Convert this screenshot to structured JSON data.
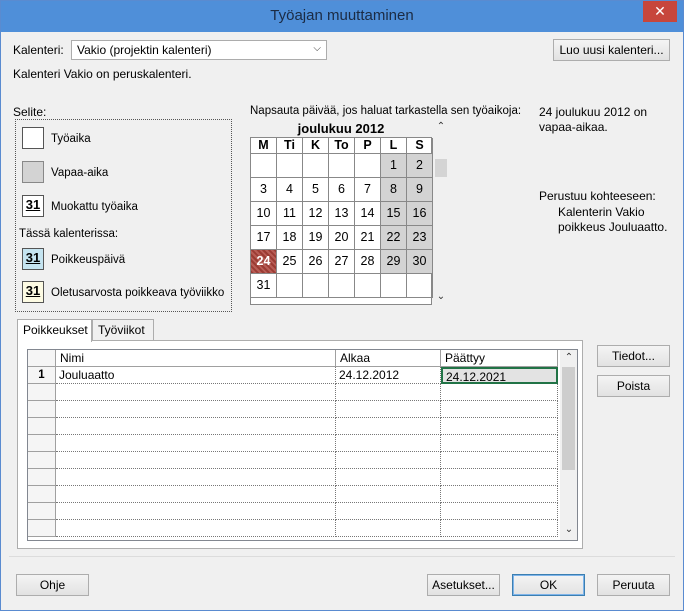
{
  "window": {
    "title": "Työajan muuttaminen",
    "close": "✕"
  },
  "calendar_select": {
    "label": "Kalenteri:",
    "value": "Vakio (projektin kalenteri)",
    "new_button": "Luo uusi kalenteri...",
    "base_note": "Kalenteri Vakio on peruskalenteri."
  },
  "legend": {
    "title": "Selite:",
    "items": [
      {
        "label": "Työaika"
      },
      {
        "label": "Vapaa-aika"
      },
      {
        "label": "Muokattu työaika",
        "num": "31"
      }
    ],
    "in_calendar": "Tässä kalenterissa:",
    "items2": [
      {
        "label": "Poikkeuspäivä",
        "num": "31"
      },
      {
        "label": "Oletusarvosta poikkeava työviikko",
        "num": "31"
      }
    ]
  },
  "month_view": {
    "instruction": "Napsauta päivää, jos haluat tarkastella sen työaikoja:",
    "month": "joulukuu 2012",
    "weekdays": [
      "M",
      "Ti",
      "K",
      "To",
      "P",
      "L",
      "S"
    ],
    "weeks": [
      [
        "",
        "",
        "",
        "",
        "",
        "1",
        "2"
      ],
      [
        "3",
        "4",
        "5",
        "6",
        "7",
        "8",
        "9"
      ],
      [
        "10",
        "11",
        "12",
        "13",
        "14",
        "15",
        "16"
      ],
      [
        "17",
        "18",
        "19",
        "20",
        "21",
        "22",
        "23"
      ],
      [
        "24",
        "25",
        "26",
        "27",
        "28",
        "29",
        "30"
      ],
      [
        "31",
        "",
        "",
        "",
        "",
        "",
        ""
      ]
    ],
    "selected_day": "24"
  },
  "info": {
    "selected_text": "24 joulukuu 2012 on vapaa-aikaa.",
    "based_on_title": "Perustuu kohteeseen:",
    "based_on_text": "Kalenterin Vakio poikkeus Jouluaatto."
  },
  "tabs": [
    {
      "label": "Poikkeukset"
    },
    {
      "label": "Työviikot"
    }
  ],
  "exceptions": {
    "columns": [
      "Nimi",
      "Alkaa",
      "Päättyy"
    ],
    "rows": [
      {
        "num": "1",
        "name": "Jouluaatto",
        "start": "24.12.2012",
        "end": "24.12.2021"
      }
    ]
  },
  "side_buttons": {
    "details": "Tiedot...",
    "delete": "Poista"
  },
  "footer": {
    "help": "Ohje",
    "options": "Asetukset...",
    "ok": "OK",
    "cancel": "Peruuta"
  }
}
